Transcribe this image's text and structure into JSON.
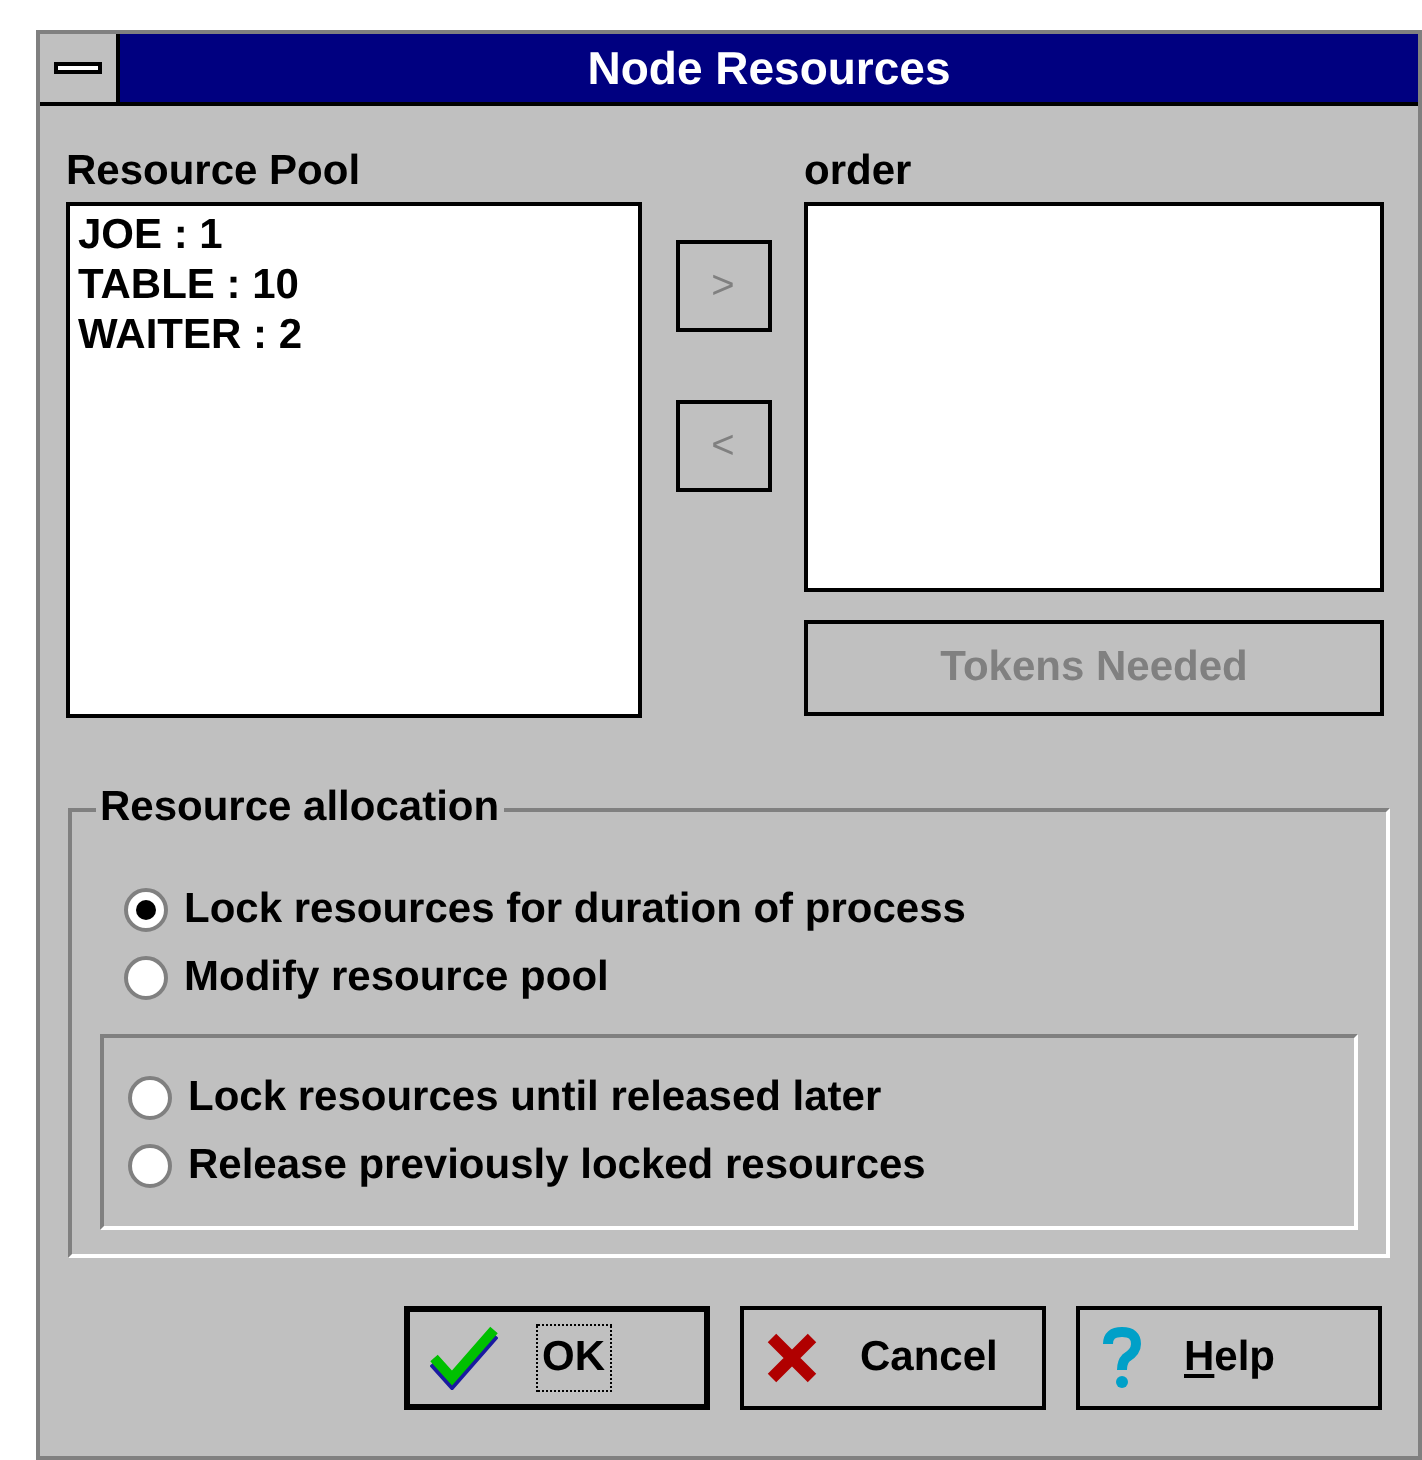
{
  "window": {
    "title": "Node Resources"
  },
  "resource_pool": {
    "label": "Resource Pool",
    "items": [
      {
        "text": "JOE : 1"
      },
      {
        "text": "TABLE : 10"
      },
      {
        "text": "WAITER : 2"
      }
    ]
  },
  "move_buttons": [
    {
      "label": ">",
      "disabled": true
    },
    {
      "label": "<",
      "disabled": true
    }
  ],
  "order": {
    "label": "order"
  },
  "tokens_button": {
    "label": "Tokens Needed",
    "disabled": true
  },
  "allocation": {
    "title": "Resource allocation",
    "options": [
      {
        "label": "Lock resources for duration of process",
        "selected": true
      },
      {
        "label": "Modify resource pool",
        "selected": false
      }
    ],
    "inner_options": [
      {
        "label": "Lock resources until released later",
        "selected": false
      },
      {
        "label": "Release previously locked resources",
        "selected": false
      }
    ]
  },
  "buttons": [
    {
      "kind": "ok",
      "label": "OK",
      "default": true,
      "mnemonic": false
    },
    {
      "kind": "cancel",
      "label": "Cancel",
      "default": false,
      "mnemonic": false
    },
    {
      "kind": "help",
      "label": "Help",
      "default": false,
      "mnemonic": true
    }
  ]
}
